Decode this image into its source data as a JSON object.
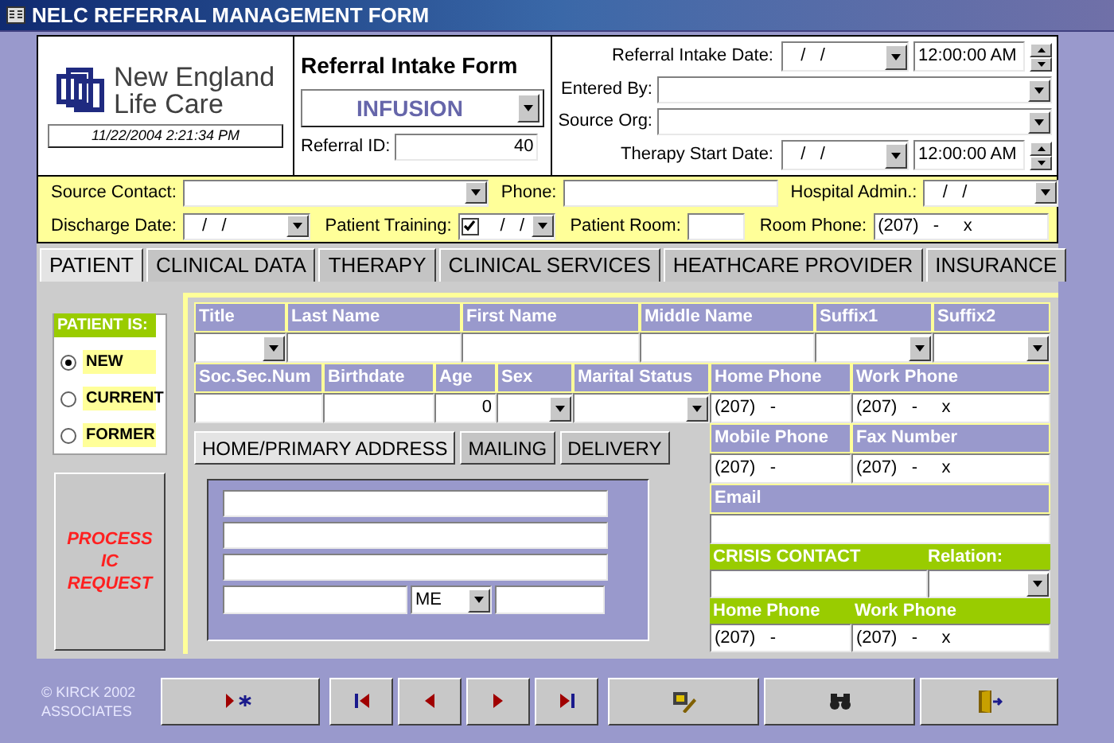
{
  "window": {
    "title": "NELC REFERRAL MANAGEMENT FORM"
  },
  "logo": {
    "line1": "New England",
    "line2": "Life Care"
  },
  "timestamp": "11/22/2004 2:21:34 PM",
  "form_title": "Referral Intake Form",
  "therapy": {
    "value": "INFUSION"
  },
  "referral_id": {
    "label": "Referral ID:",
    "value": "40"
  },
  "intake": [
    {
      "kind": "datetime",
      "label": "Referral Intake Date:",
      "date": "/   /",
      "time": "12:00:00 AM"
    },
    {
      "kind": "combo",
      "label": "Entered By:"
    },
    {
      "kind": "combo",
      "label": "Source Org:"
    },
    {
      "kind": "datetime",
      "label": "Therapy Start Date:",
      "date": "/   /",
      "time": "12:00:00 AM"
    }
  ],
  "referral_rows": [
    [
      {
        "kind": "combo",
        "label": "Source Contact:"
      },
      {
        "kind": "field",
        "label": "Phone:"
      },
      {
        "kind": "date",
        "label": "Hospital Admin.:",
        "value": "/   /"
      }
    ],
    [
      {
        "kind": "date",
        "label": "Discharge Date:",
        "value": "/   /"
      },
      {
        "kind": "check_date",
        "label": "Patient Training:",
        "value": "/   /",
        "checked": true
      },
      {
        "kind": "field",
        "label": "Patient Room:"
      },
      {
        "kind": "field",
        "label": "Room Phone:",
        "value": "(207)   -     x"
      }
    ]
  ],
  "tabs": [
    {
      "label": "PATIENT",
      "selected": true
    },
    {
      "label": "CLINICAL DATA",
      "selected": false
    },
    {
      "label": "THERAPY",
      "selected": false
    },
    {
      "label": "CLINICAL SERVICES",
      "selected": false
    },
    {
      "label": "HEATHCARE PROVIDER",
      "selected": false
    },
    {
      "label": "INSURANCE",
      "selected": false
    }
  ],
  "patient_status": {
    "title": "PATIENT IS:",
    "options": [
      {
        "label": "NEW",
        "selected": true
      },
      {
        "label": "CURRENT",
        "selected": false
      },
      {
        "label": "FORMER",
        "selected": false
      }
    ]
  },
  "process_button": {
    "label": "PROCESS IC REQUEST"
  },
  "name_row": [
    {
      "header": "Title",
      "kind": "combo"
    },
    {
      "header": "Last Name",
      "kind": "field"
    },
    {
      "header": "First Name",
      "kind": "field"
    },
    {
      "header": "Middle Name",
      "kind": "field"
    },
    {
      "header": "Suffix1",
      "kind": "combo"
    },
    {
      "header": "Suffix2",
      "kind": "combo"
    }
  ],
  "detail_row": [
    {
      "header": "Soc.Sec.Num",
      "kind": "field"
    },
    {
      "header": "Birthdate",
      "kind": "field"
    },
    {
      "header": "Age",
      "kind": "field",
      "value": "0"
    },
    {
      "header": "Sex",
      "kind": "combo"
    },
    {
      "header": "Marital Status",
      "kind": "combo"
    },
    {
      "header": "Home Phone",
      "kind": "field",
      "value": "(207)   -"
    },
    {
      "header": "Work Phone",
      "kind": "field",
      "value": "(207)   -     x"
    }
  ],
  "address_tabs": [
    {
      "label": "HOME/PRIMARY ADDRESS",
      "selected": true
    },
    {
      "label": "MAILING",
      "selected": false
    },
    {
      "label": "DELIVERY",
      "selected": false
    }
  ],
  "address": {
    "state": "ME"
  },
  "phones": [
    {
      "header": "Mobile Phone",
      "value": "(207)   -"
    },
    {
      "header": "Fax Number",
      "value": "(207)   -     x"
    }
  ],
  "email": {
    "header": "Email"
  },
  "crisis_contact": {
    "title": "CRISIS CONTACT",
    "relation_label": "Relation:",
    "phones": [
      {
        "header": "Home Phone",
        "value": "(207)   -"
      },
      {
        "header": "Work Phone",
        "value": "(207)   -     x"
      }
    ]
  },
  "footer": {
    "copyright": "© KIRCK 2002 ASSOCIATES"
  }
}
